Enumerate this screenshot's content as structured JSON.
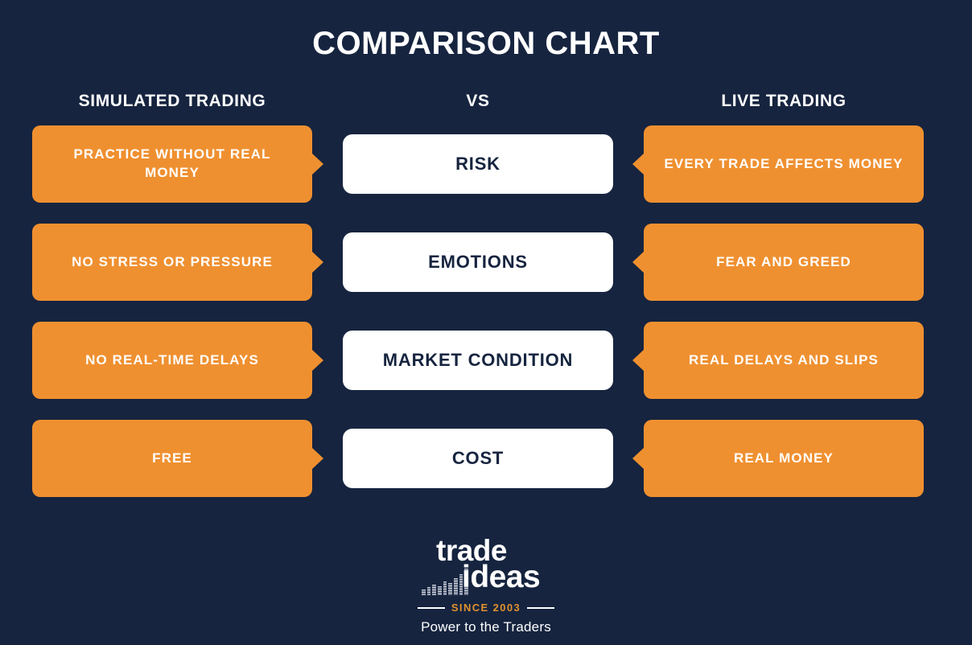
{
  "title": "COMPARISON CHART",
  "theme": {
    "background": "#16243f",
    "accent_orange": "#ef9030",
    "card_white": "#ffffff",
    "text_navy": "#16243f",
    "since_orange": "#e0912f"
  },
  "headers": {
    "left": "SIMULATED TRADING",
    "center": "VS",
    "right": "LIVE TRADING"
  },
  "chart_data": {
    "type": "table",
    "title": "COMPARISON CHART",
    "columns": [
      "SIMULATED TRADING",
      "VS",
      "LIVE TRADING"
    ],
    "rows": [
      {
        "criterion": "RISK",
        "simulated": "PRACTICE WITHOUT REAL MONEY",
        "live": "EVERY TRADE AFFECTS MONEY"
      },
      {
        "criterion": "EMOTIONS",
        "simulated": "NO STRESS OR PRESSURE",
        "live": "FEAR AND GREED"
      },
      {
        "criterion": "MARKET CONDITION",
        "simulated": "NO REAL-TIME DELAYS",
        "live": "REAL DELAYS AND SLIPS"
      },
      {
        "criterion": "COST",
        "simulated": "FREE",
        "live": "REAL MONEY"
      }
    ]
  },
  "rows": [
    {
      "left": "PRACTICE WITHOUT REAL MONEY",
      "center": "RISK",
      "right": "EVERY TRADE AFFECTS MONEY"
    },
    {
      "left": "NO STRESS OR PRESSURE",
      "center": "EMOTIONS",
      "right": "FEAR AND GREED"
    },
    {
      "left": "NO REAL-TIME DELAYS",
      "center": "MARKET CONDITION",
      "right": "REAL DELAYS AND SLIPS"
    },
    {
      "left": "FREE",
      "center": "COST",
      "right": "REAL MONEY"
    }
  ],
  "logo": {
    "word_top": "trade",
    "word_bottom": "ideas",
    "since": "SINCE 2003",
    "tagline": "Power to the Traders",
    "bars_icon": "bar-chart-icon"
  }
}
